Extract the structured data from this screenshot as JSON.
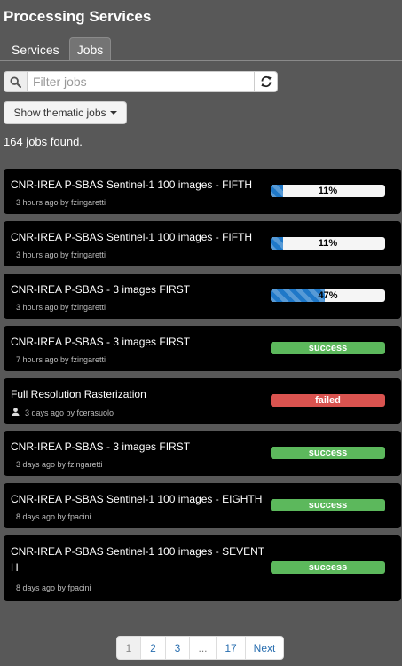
{
  "header": {
    "title": "Processing Services"
  },
  "tabs": [
    {
      "label": "Services",
      "active": false
    },
    {
      "label": "Jobs",
      "active": true
    }
  ],
  "filter": {
    "placeholder": "Filter jobs",
    "value": ""
  },
  "thematic_button": {
    "label": "Show thematic jobs"
  },
  "summary": {
    "count_text": "164 jobs found."
  },
  "jobs": [
    {
      "title": "CNR-IREA P-SBAS Sentinel-1 100 images - FIFTH",
      "meta": "3 hours ago by fzingaretti",
      "status": "progress",
      "progress_label": "11%",
      "progress": 0.11,
      "icon": null
    },
    {
      "title": "CNR-IREA P-SBAS Sentinel-1 100 images - FIFTH",
      "meta": "3 hours ago by fzingaretti",
      "status": "progress",
      "progress_label": "11%",
      "progress": 0.11,
      "icon": null
    },
    {
      "title": "CNR-IREA P-SBAS - 3 images FIRST",
      "meta": "3 hours ago by fzingaretti",
      "status": "progress",
      "progress_label": "47%",
      "progress": 0.47,
      "icon": null
    },
    {
      "title": "CNR-IREA P-SBAS - 3 images FIRST",
      "meta": "7 hours ago by fzingaretti",
      "status": "success",
      "status_label": "success",
      "icon": null
    },
    {
      "title": "Full Resolution Rasterization",
      "meta": "3 days ago by fcerasuolo",
      "status": "failed",
      "status_label": "failed",
      "icon": "user-icon"
    },
    {
      "title": "CNR-IREA P-SBAS - 3 images FIRST",
      "meta": "3 days ago by fzingaretti",
      "status": "success",
      "status_label": "success",
      "icon": null
    },
    {
      "title": "CNR-IREA P-SBAS Sentinel-1 100 images - EIGHTH",
      "meta": "8 days ago by fpacini",
      "status": "success",
      "status_label": "success",
      "icon": null
    },
    {
      "title": "CNR-IREA P-SBAS Sentinel-1 100 images - SEVENT H",
      "meta": "8 days ago by fpacini",
      "status": "success",
      "status_label": "success",
      "icon": null
    }
  ],
  "pagination": {
    "pages": [
      "1",
      "2",
      "3",
      "...",
      "17",
      "Next"
    ],
    "current": "1"
  },
  "colors": {
    "background": "#585858",
    "card": "#000000",
    "progress": "#1f78c8",
    "success": "#5cb85c",
    "failed": "#d9534f",
    "link": "#2a6fb0"
  }
}
